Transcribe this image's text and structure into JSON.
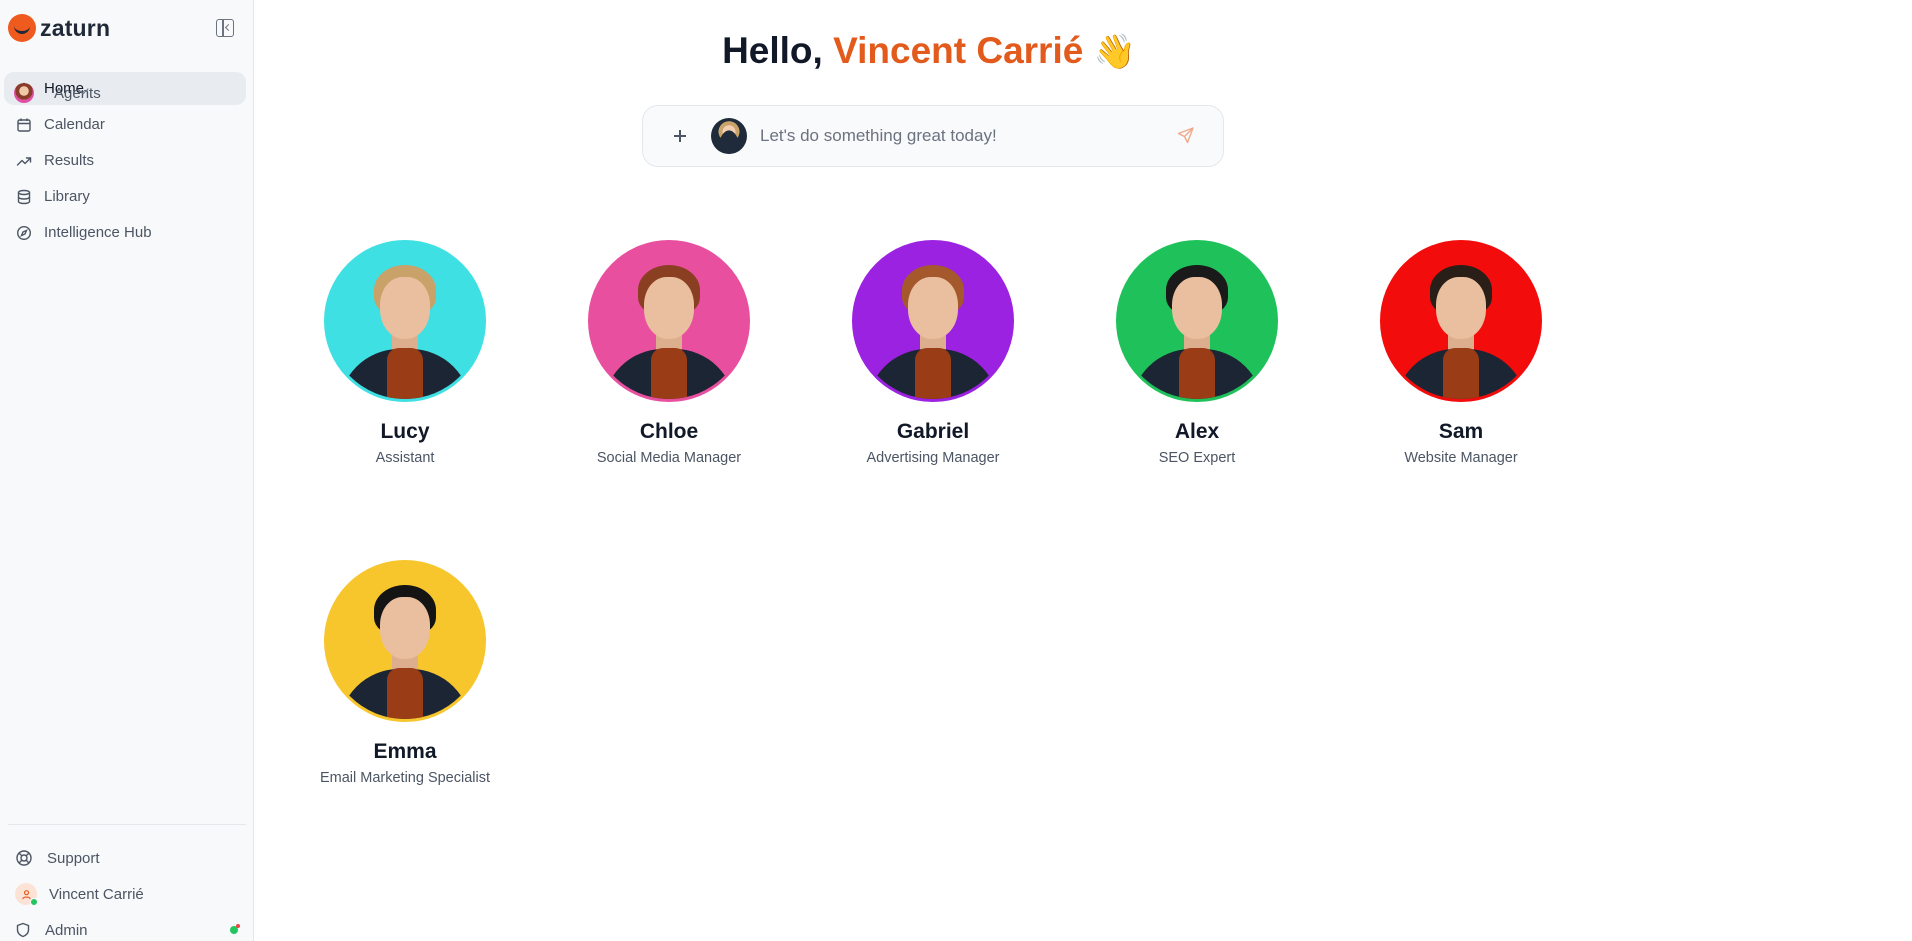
{
  "app": {
    "name": "zaturn"
  },
  "sidebar": {
    "items": [
      {
        "label": "Home",
        "icon": "home-icon",
        "active": true
      },
      {
        "label": "Agents",
        "icon": "agent-avatar",
        "expandable": true
      },
      {
        "label": "Calendar",
        "icon": "calendar-icon"
      },
      {
        "label": "Results",
        "icon": "trending-up-icon"
      },
      {
        "label": "Library",
        "icon": "database-icon"
      },
      {
        "label": "Intelligence Hub",
        "icon": "compass-icon"
      }
    ],
    "bottom": {
      "support": "Support",
      "user": "Vincent Carrié",
      "admin": "Admin"
    }
  },
  "greeting": {
    "prefix": "Hello,",
    "name": "Vincent Carrié",
    "emoji": "👋"
  },
  "prompt": {
    "placeholder": "Let's do something great today!"
  },
  "agents": [
    {
      "name": "Lucy",
      "role": "Assistant",
      "color": "#3ee0e3",
      "hair": "#c9a26a"
    },
    {
      "name": "Chloe",
      "role": "Social Media Manager",
      "color": "#e8509f",
      "hair": "#8b3f22"
    },
    {
      "name": "Gabriel",
      "role": "Advertising Manager",
      "color": "#9b22e0",
      "hair": "#a4582c"
    },
    {
      "name": "Alex",
      "role": "SEO Expert",
      "color": "#1fc25a",
      "hair": "#1a1a1a"
    },
    {
      "name": "Sam",
      "role": "Website Manager",
      "color": "#f30c0c",
      "hair": "#2a1e18"
    },
    {
      "name": "Emma",
      "role": "Email Marketing Specialist",
      "color": "#f7c62c",
      "hair": "#141414"
    }
  ],
  "colors": {
    "accent": "#e25a1c",
    "sidebar_bg": "#f8f9fa",
    "active_item_bg": "#e8ebef",
    "online": "#22c55e"
  }
}
